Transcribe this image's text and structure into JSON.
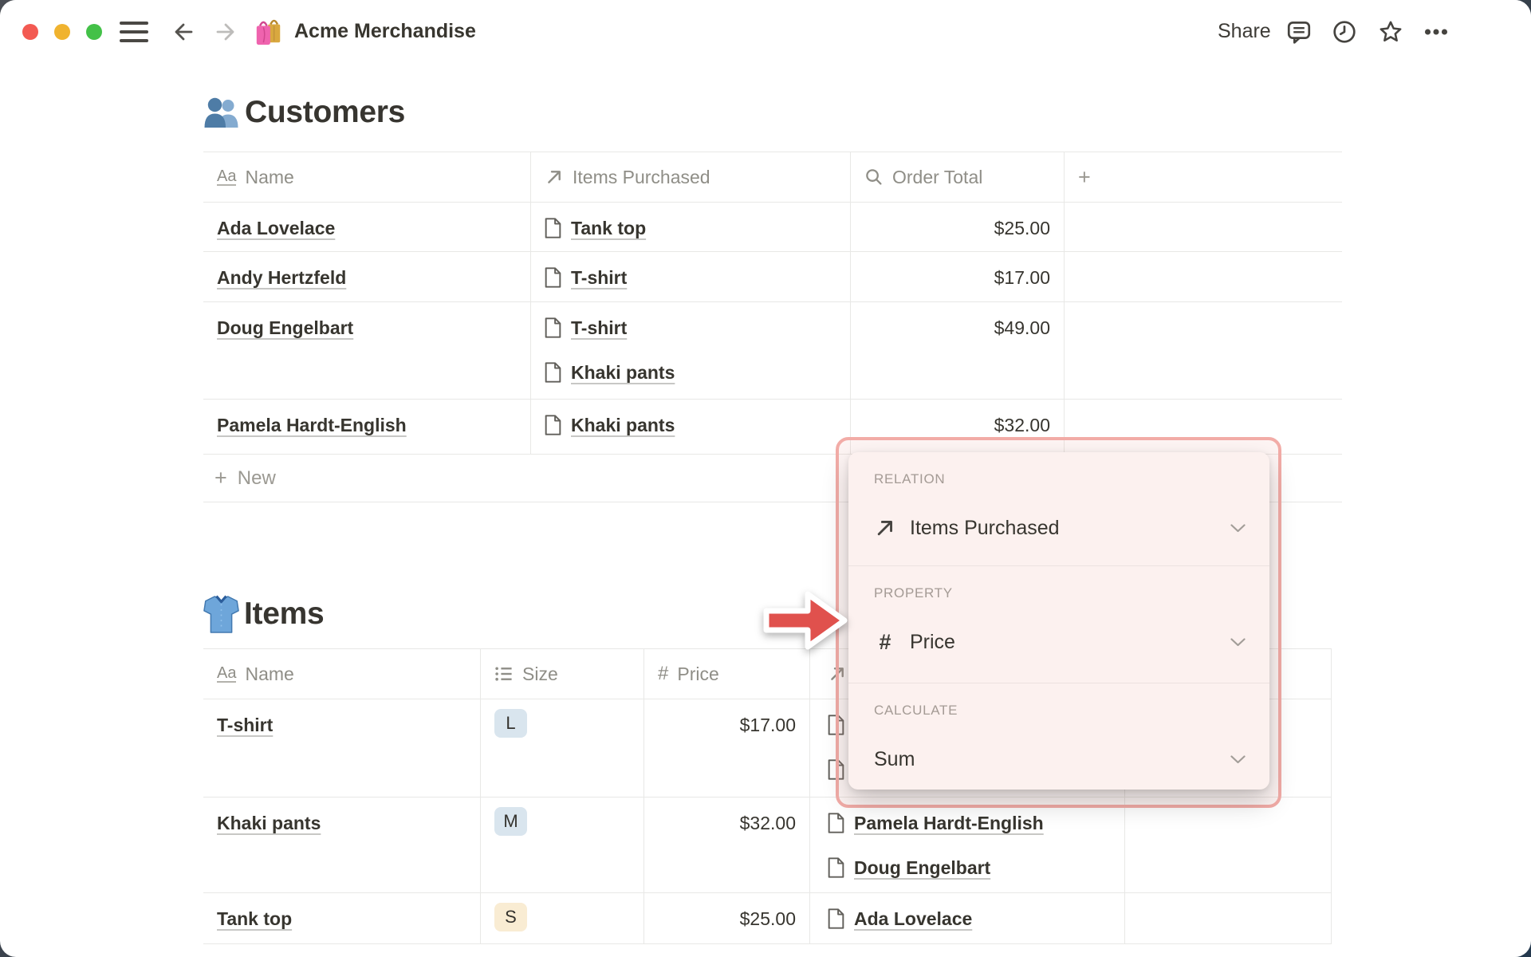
{
  "colors": {
    "text-dark": "#37352f",
    "text-gray": "#8f8e87",
    "table-border": "#e8e8e6",
    "tag-blue": "#d9e5ee",
    "tag-yellow": "#f9ecd3",
    "popup-border": "#f2aca7",
    "popup-bg": "#fcf1ef",
    "arrow-red": "#e0514d",
    "traffic-red": "#f35a52",
    "traffic-yellow": "#f0b32f",
    "traffic-green": "#43c148"
  },
  "topbar": {
    "title": "Acme Merchandise",
    "share_label": "Share"
  },
  "icons": {
    "plus": "+",
    "hash": "#",
    "title_prop": "Aa"
  },
  "customers": {
    "heading": "Customers",
    "columns": [
      {
        "label": "Name",
        "icon": "title"
      },
      {
        "label": "Items Purchased",
        "icon": "relation"
      },
      {
        "label": "Order Total",
        "icon": "rollup"
      }
    ],
    "rows": [
      {
        "name": "Ada Lovelace",
        "items": [
          "Tank top"
        ],
        "order_total": "$25.00"
      },
      {
        "name": "Andy Hertzfeld",
        "items": [
          "T-shirt"
        ],
        "order_total": "$17.00"
      },
      {
        "name": "Doug Engelbart",
        "items": [
          "T-shirt",
          "Khaki pants"
        ],
        "order_total": "$49.00"
      },
      {
        "name": "Pamela Hardt-English",
        "items": [
          "Khaki pants"
        ],
        "order_total": "$32.00"
      }
    ],
    "new_row_label": "New"
  },
  "items": {
    "heading": "Items",
    "columns": [
      {
        "label": "Name",
        "icon": "title"
      },
      {
        "label": "Size",
        "icon": "select"
      },
      {
        "label": "Price",
        "icon": "number"
      },
      {
        "label": "",
        "icon": "relation"
      }
    ],
    "rows": [
      {
        "name": "T-shirt",
        "size": "L",
        "size_color": "blue",
        "price": "$17.00",
        "purchased_by": [],
        "hidden_purchaser_icons": 2
      },
      {
        "name": "Khaki pants",
        "size": "M",
        "size_color": "blue",
        "price": "$32.00",
        "purchased_by": [
          "Pamela Hardt-English",
          "Doug Engelbart"
        ]
      },
      {
        "name": "Tank top",
        "size": "S",
        "size_color": "yellow",
        "price": "$25.00",
        "purchased_by": [
          "Ada Lovelace"
        ]
      }
    ]
  },
  "popup": {
    "relation_label": "RELATION",
    "relation_value": "Items Purchased",
    "property_label": "PROPERTY",
    "property_value": "Price",
    "calculate_label": "CALCULATE",
    "calculate_value": "Sum"
  }
}
